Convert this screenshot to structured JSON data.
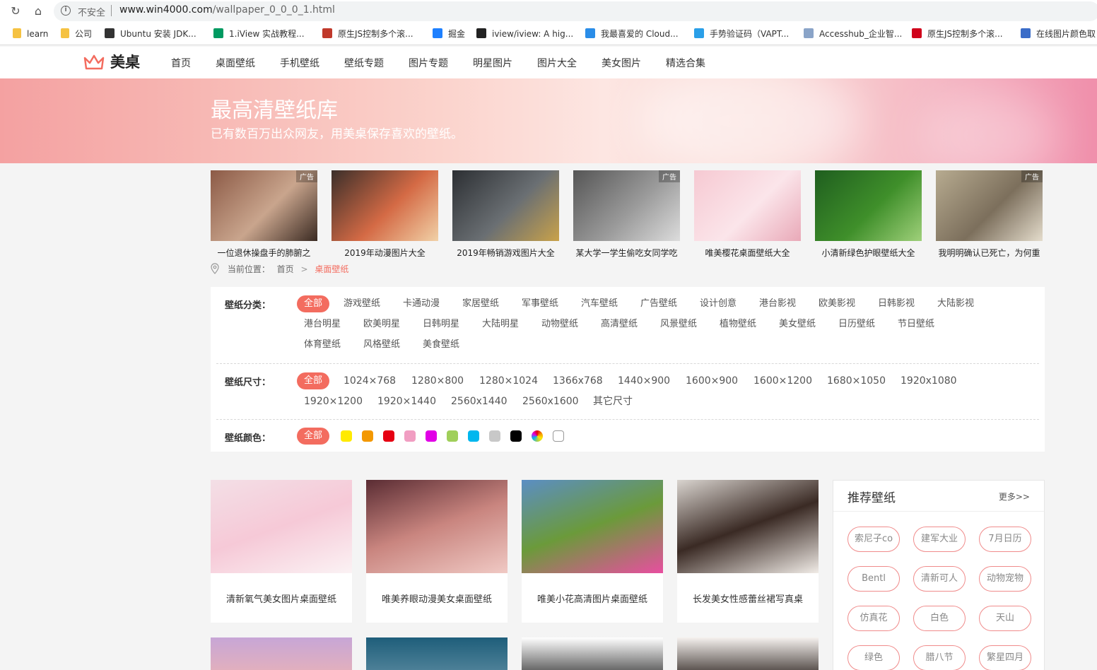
{
  "browser": {
    "insecure_label": "不安全",
    "url_host": "www.win4000.com",
    "url_path": "/wallpaper_0_0_0_1.html",
    "bookmarks": [
      {
        "label": "learn",
        "icon": "folder-icon",
        "color": "#f5c242"
      },
      {
        "label": "公司",
        "icon": "folder-icon",
        "color": "#f5c242"
      },
      {
        "label": "Ubuntu 安装 JDK...",
        "icon": "linux-icon",
        "color": "#333333"
      },
      {
        "label": "1.iView 实战教程...",
        "icon": "segmentfault-icon",
        "color": "#009a61"
      },
      {
        "label": "原生JS控制多个滚...",
        "icon": "b-icon",
        "color": "#c0392b"
      },
      {
        "label": "掘金",
        "icon": "juejin-icon",
        "color": "#1e80ff"
      },
      {
        "label": "iview/iview: A hig...",
        "icon": "github-icon",
        "color": "#222222"
      },
      {
        "label": "我最喜爱的 Cloud...",
        "icon": "cloud-icon",
        "color": "#2a8de8"
      },
      {
        "label": "手势验证码（VAPT...",
        "icon": "shield-icon",
        "color": "#2a9fe8"
      },
      {
        "label": "Accesshub_企业智...",
        "icon": "share-icon",
        "color": "#8aa4c8"
      },
      {
        "label": "原生JS控制多个滚...",
        "icon": "c-icon",
        "color": "#d0021b"
      },
      {
        "label": "在线图片颜色取",
        "icon": "n-icon",
        "color": "#3a6cc8"
      }
    ]
  },
  "header": {
    "logo_text": "美桌",
    "nav": [
      "首页",
      "桌面壁纸",
      "手机壁纸",
      "壁纸专题",
      "图片专题",
      "明星图片",
      "图片大全",
      "美女图片",
      "精选合集"
    ]
  },
  "banner": {
    "title": "最高清壁纸库",
    "subtitle": "已有数百万出众网友，用美桌保存喜欢的壁纸。"
  },
  "featured": [
    {
      "caption": "一位退休操盘手的肺腑之",
      "ad": "广告",
      "colors": [
        "#8c5a46",
        "#c9a58d",
        "#3a2a22"
      ]
    },
    {
      "caption": "2019年动漫图片大全",
      "ad": "",
      "colors": [
        "#3b2f2a",
        "#d46a45",
        "#f1d1a7"
      ]
    },
    {
      "caption": "2019年畅销游戏图片大全",
      "ad": "",
      "colors": [
        "#2c2f33",
        "#6a6f73",
        "#c9a24a"
      ]
    },
    {
      "caption": "某大学一学生偷吃女同学吃",
      "ad": "广告",
      "colors": [
        "#555555",
        "#9a9a9a",
        "#dcdcdc"
      ]
    },
    {
      "caption": "唯美樱花桌面壁纸大全",
      "ad": "",
      "colors": [
        "#f6c9d2",
        "#fbe5ea",
        "#e9a9b8"
      ]
    },
    {
      "caption": "小清新绿色护眼壁纸大全",
      "ad": "",
      "colors": [
        "#1f5e1f",
        "#3f8f2a",
        "#9fd07a"
      ]
    },
    {
      "caption": "我明明确认已死亡，为何重",
      "ad": "广告",
      "colors": [
        "#b7ab90",
        "#7c6f5c",
        "#e4dccc"
      ]
    }
  ],
  "breadcrumb": {
    "prefix": "当前位置：",
    "home": "首页",
    "sep": ">",
    "current": "桌面壁纸"
  },
  "filters": {
    "category_label": "壁纸分类：",
    "categories": [
      "全部",
      "游戏壁纸",
      "卡通动漫",
      "家居壁纸",
      "军事壁纸",
      "汽车壁纸",
      "广告壁纸",
      "设计创意",
      "港台影视",
      "欧美影视",
      "日韩影视",
      "大陆影视",
      "港台明星",
      "欧美明星",
      "日韩明星",
      "大陆明星",
      "动物壁纸",
      "高清壁纸",
      "风景壁纸",
      "植物壁纸",
      "美女壁纸",
      "日历壁纸",
      "节日壁纸",
      "体育壁纸",
      "风格壁纸",
      "美食壁纸"
    ],
    "size_label": "壁纸尺寸：",
    "sizes": [
      "全部",
      "1024×768",
      "1280×800",
      "1280×1024",
      "1366x768",
      "1440×900",
      "1600×900",
      "1600×1200",
      "1680×1050",
      "1920x1080",
      "1920×1200",
      "1920×1440",
      "2560x1440",
      "2560x1600",
      "其它尺寸"
    ],
    "color_label": "壁纸颜色：",
    "color_all": "全部",
    "colors": [
      "#ffea00",
      "#f39800",
      "#e60012",
      "#f19ec2",
      "#e100e6",
      "#a0cf5a",
      "#00b7ee",
      "#c8c8c8",
      "#000000",
      "multicolor",
      "#ffffff"
    ]
  },
  "grid": [
    {
      "caption": "清新氧气美女图片桌面壁纸",
      "colors": [
        "#f3dfe6",
        "#f6c9d7",
        "#fbf2f4"
      ]
    },
    {
      "caption": "唯美养眼动漫美女桌面壁纸",
      "colors": [
        "#5a2c33",
        "#c9857f",
        "#f0c9c4"
      ]
    },
    {
      "caption": "唯美小花高清图片桌面壁纸",
      "colors": [
        "#5b8ec4",
        "#6b9a3a",
        "#e84ea0"
      ]
    },
    {
      "caption": "长发美女性感蕾丝裙写真桌",
      "colors": [
        "#d9d4cf",
        "#3a2a24",
        "#f1ece7"
      ]
    }
  ],
  "grid_row2_colors": [
    [
      "#c7a6d6",
      "#e9b2b7"
    ],
    [
      "#1e5e7a",
      "#5a8aa0"
    ],
    [
      "#ffffff",
      "#3a3a3a"
    ],
    [
      "#f5f1ee",
      "#2f2622"
    ]
  ],
  "sidebar": {
    "title": "推荐壁纸",
    "more": "更多>>",
    "tags": [
      "索尼子co",
      "建军大业",
      "7月日历",
      "Bentl",
      "清新可人",
      "动物宠物",
      "仿真花",
      "白色",
      "天山",
      "绿色",
      "腊八节",
      "繁星四月"
    ]
  }
}
